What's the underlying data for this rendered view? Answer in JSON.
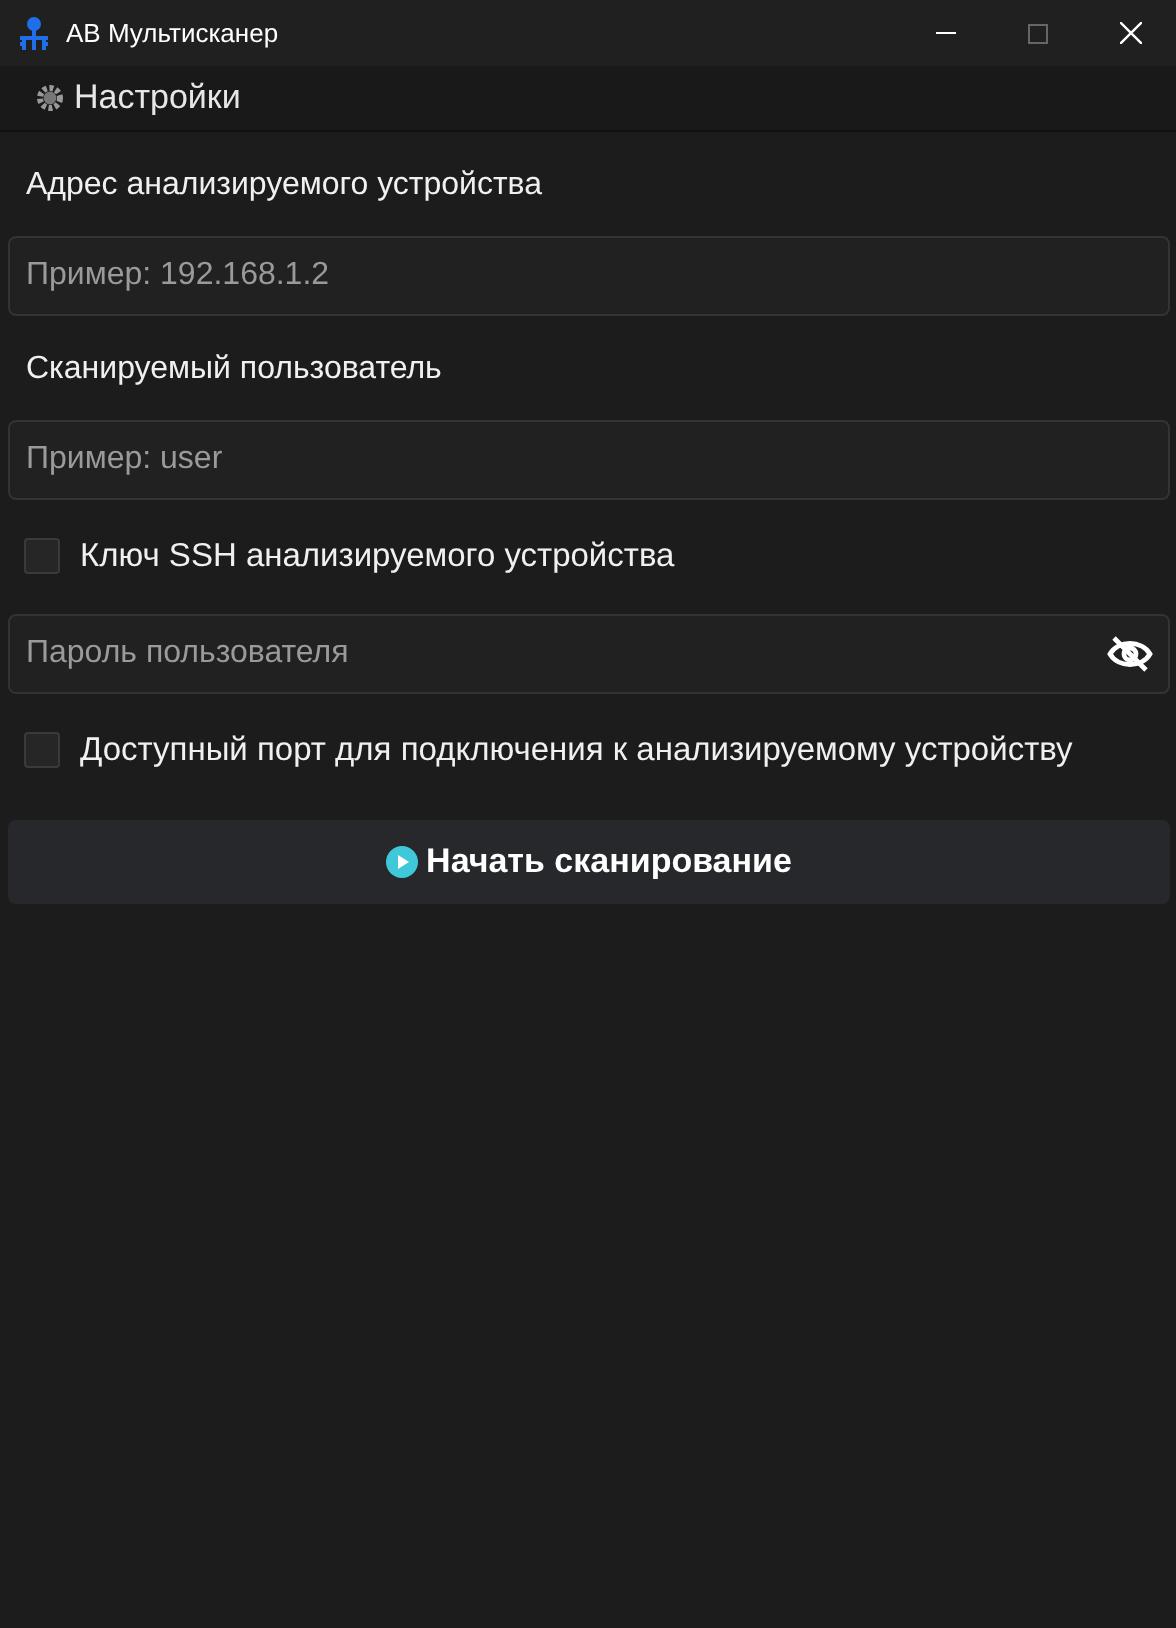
{
  "window": {
    "title": "АВ Мультисканер"
  },
  "tab": {
    "label": "Настройки"
  },
  "form": [
    {
      "kind": "label",
      "text": "Адрес анализируемого устройства"
    },
    {
      "kind": "field",
      "placeholder": "Пример: 192.168.1.2"
    },
    {
      "kind": "label",
      "text": "Сканируемый пользователь"
    },
    {
      "kind": "field",
      "placeholder": "Пример: user"
    },
    {
      "kind": "checkbox",
      "text": "Ключ SSH анализируемого устройства",
      "checked": false
    },
    {
      "kind": "password",
      "placeholder": "Пароль пользователя"
    },
    {
      "kind": "checkbox",
      "text": "Доступный порт для подключения к анализируемому устройству",
      "checked": false
    }
  ],
  "scan_button": {
    "label": "Начать сканирование"
  }
}
